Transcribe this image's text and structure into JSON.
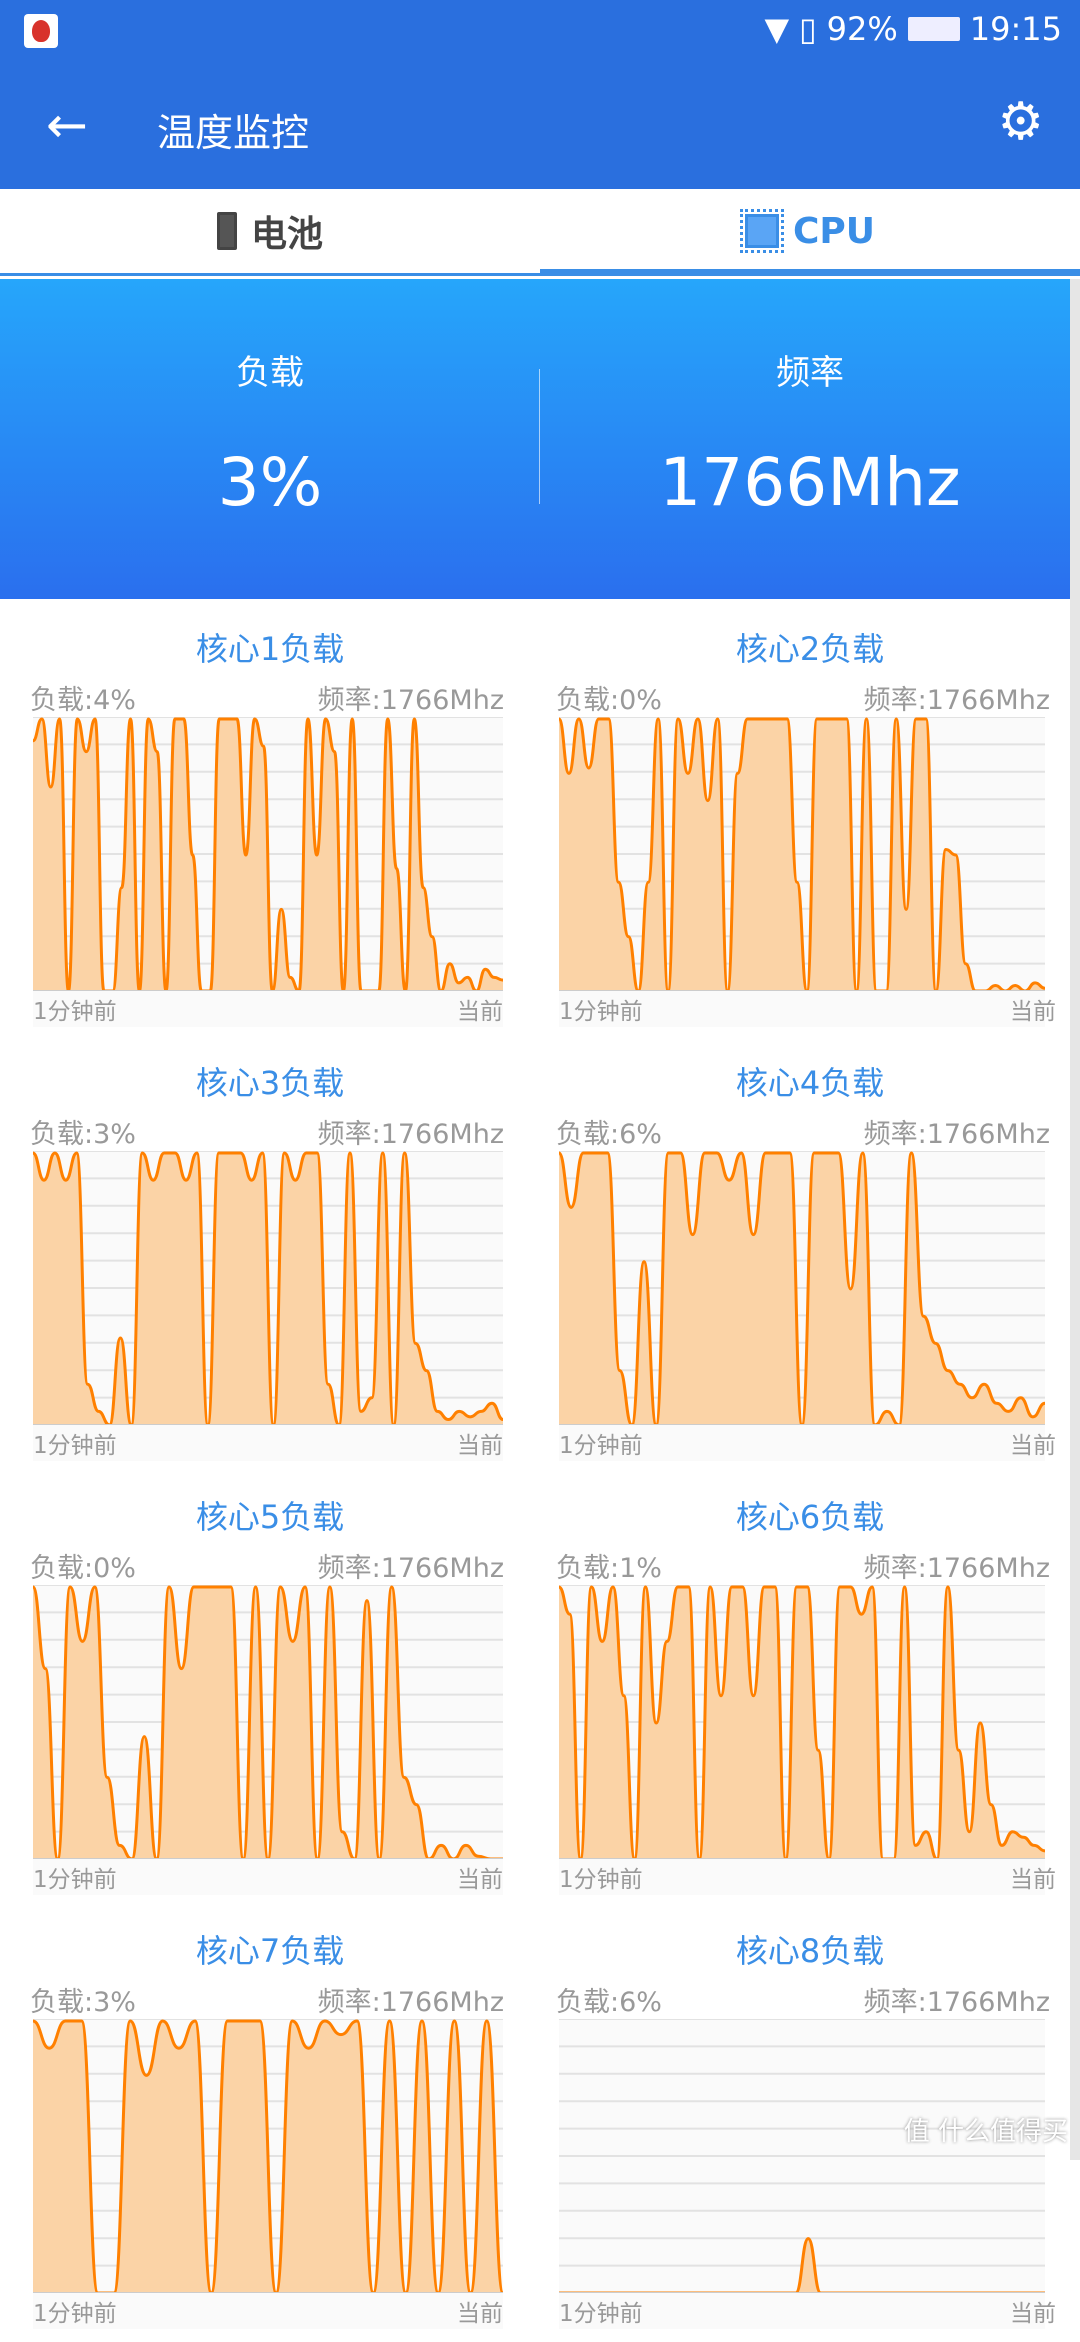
{
  "status": {
    "battery": "92%",
    "time": "19:15",
    "icons": [
      "wifi-icon",
      "sim-icon",
      "battery-icon"
    ]
  },
  "appbar": {
    "title": "温度监控",
    "back_icon": "arrow-left-icon",
    "settings_icon": "gear-icon"
  },
  "tabs": [
    {
      "label": "电池",
      "icon": "battery-icon",
      "selected": false
    },
    {
      "label": "CPU",
      "icon": "chip-icon",
      "selected": true
    }
  ],
  "summary": {
    "load_label": "负载",
    "load_value": "3%",
    "freq_label": "频率",
    "freq_value": "1766Mhz"
  },
  "colors": {
    "primary": "#2a6fde",
    "accent": "#3a8ee6",
    "line": "#ff8000",
    "fill": "#fbd3a6"
  },
  "cores": [
    {
      "title": "核心1负载",
      "load": "负载:4%",
      "freq": "频率:1766Mhz",
      "x_start": "1分钟前",
      "x_end": "当前"
    },
    {
      "title": "核心2负载",
      "load": "负载:0%",
      "freq": "频率:1766Mhz",
      "x_start": "1分钟前",
      "x_end": "当前"
    },
    {
      "title": "核心3负载",
      "load": "负载:3%",
      "freq": "频率:1766Mhz",
      "x_start": "1分钟前",
      "x_end": "当前"
    },
    {
      "title": "核心4负载",
      "load": "负载:6%",
      "freq": "频率:1766Mhz",
      "x_start": "1分钟前",
      "x_end": "当前"
    },
    {
      "title": "核心5负载",
      "load": "负载:0%",
      "freq": "频率:1766Mhz",
      "x_start": "1分钟前",
      "x_end": "当前"
    },
    {
      "title": "核心6负载",
      "load": "负载:1%",
      "freq": "频率:1766Mhz",
      "x_start": "1分钟前",
      "x_end": "当前"
    },
    {
      "title": "核心7负载",
      "load": "负载:3%",
      "freq": "频率:1766Mhz",
      "x_start": "1分钟前",
      "x_end": "当前"
    },
    {
      "title": "核心8负载",
      "load": "负载:6%",
      "freq": "频率:1766Mhz",
      "x_start": "1分钟前",
      "x_end": "当前"
    }
  ],
  "chart_data": [
    {
      "type": "area",
      "ylim": [
        0,
        100
      ],
      "grid": true,
      "values": [
        92,
        100,
        75,
        100,
        0,
        100,
        88,
        100,
        0,
        0,
        38,
        100,
        0,
        100,
        88,
        0,
        100,
        100,
        50,
        0,
        0,
        100,
        100,
        100,
        50,
        100,
        90,
        0,
        30,
        5,
        0,
        100,
        50,
        100,
        88,
        0,
        100,
        0,
        0,
        0,
        100,
        45,
        0,
        100,
        38,
        20,
        0,
        10,
        3,
        5,
        0,
        8,
        5,
        4
      ]
    },
    {
      "type": "area",
      "ylim": [
        0,
        100
      ],
      "grid": true,
      "values": [
        100,
        80,
        100,
        82,
        100,
        100,
        40,
        20,
        0,
        40,
        100,
        0,
        100,
        80,
        100,
        70,
        100,
        0,
        80,
        100,
        100,
        100,
        100,
        100,
        40,
        0,
        100,
        100,
        100,
        100,
        0,
        100,
        0,
        0,
        100,
        30,
        100,
        100,
        0,
        52,
        50,
        10,
        0,
        0,
        2,
        0,
        2,
        0,
        3,
        1
      ]
    },
    {
      "type": "area",
      "ylim": [
        0,
        100
      ],
      "grid": true,
      "values": [
        100,
        90,
        100,
        90,
        100,
        15,
        5,
        0,
        32,
        0,
        100,
        90,
        100,
        100,
        90,
        100,
        0,
        100,
        100,
        100,
        90,
        100,
        0,
        100,
        90,
        100,
        100,
        15,
        0,
        100,
        5,
        10,
        100,
        0,
        100,
        30,
        20,
        5,
        2,
        5,
        3,
        5,
        8,
        2
      ]
    },
    {
      "type": "area",
      "ylim": [
        0,
        100
      ],
      "grid": true,
      "values": [
        100,
        80,
        100,
        100,
        100,
        20,
        0,
        60,
        0,
        100,
        100,
        70,
        100,
        100,
        90,
        100,
        70,
        100,
        100,
        100,
        0,
        100,
        100,
        100,
        50,
        100,
        0,
        5,
        0,
        100,
        40,
        30,
        20,
        15,
        10,
        15,
        8,
        5,
        10,
        3,
        8
      ]
    },
    {
      "type": "area",
      "ylim": [
        0,
        100
      ],
      "grid": true,
      "values": [
        100,
        70,
        0,
        100,
        80,
        100,
        30,
        5,
        0,
        45,
        0,
        100,
        70,
        100,
        100,
        100,
        100,
        0,
        100,
        0,
        100,
        80,
        100,
        0,
        100,
        10,
        0,
        95,
        0,
        100,
        30,
        20,
        0,
        5,
        0,
        5,
        1,
        0,
        0
      ]
    },
    {
      "type": "area",
      "ylim": [
        0,
        100
      ],
      "grid": true,
      "values": [
        100,
        90,
        0,
        100,
        80,
        100,
        60,
        0,
        100,
        50,
        80,
        100,
        100,
        0,
        100,
        60,
        100,
        100,
        60,
        100,
        100,
        0,
        100,
        100,
        40,
        0,
        100,
        100,
        90,
        100,
        0,
        0,
        100,
        5,
        10,
        0,
        100,
        40,
        10,
        50,
        20,
        5,
        10,
        8,
        5,
        3
      ]
    },
    {
      "type": "area",
      "ylim": [
        0,
        100
      ],
      "grid": true,
      "values": [
        100,
        90,
        100,
        100,
        0,
        0,
        100,
        80,
        100,
        90,
        100,
        0,
        100,
        100,
        100,
        0,
        100,
        90,
        100,
        95,
        100,
        0,
        100,
        0,
        100,
        0,
        100,
        0,
        100,
        0
      ]
    },
    {
      "type": "area",
      "ylim": [
        0,
        100
      ],
      "grid": true,
      "values": [
        0,
        0,
        0,
        0,
        0,
        0,
        0,
        0,
        0,
        0,
        0,
        0,
        0,
        0,
        0,
        0,
        0,
        0,
        0,
        0,
        20,
        0,
        0,
        0,
        0,
        0,
        0,
        0,
        0,
        0,
        0,
        0,
        0,
        0,
        0,
        0,
        0,
        0,
        0,
        0
      ]
    }
  ],
  "watermark": "值 什么值得买"
}
